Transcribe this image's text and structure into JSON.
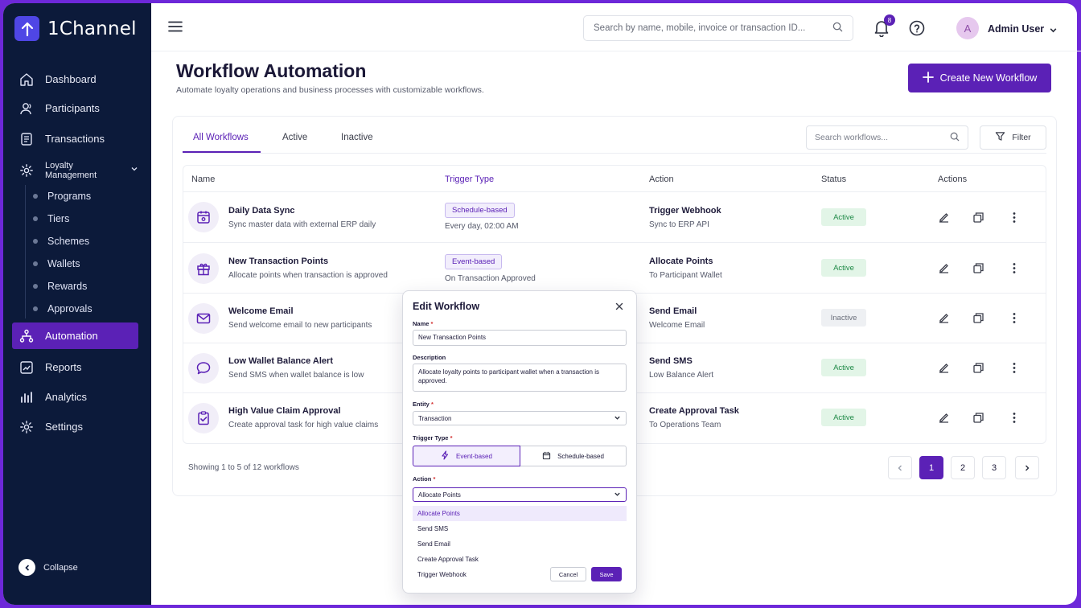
{
  "brand": {
    "name": "1Channel"
  },
  "sidebar": {
    "items": [
      {
        "label": "Dashboard",
        "icon": "home-icon"
      },
      {
        "label": "Participants",
        "icon": "users-icon"
      },
      {
        "label": "Transactions",
        "icon": "receipt-icon"
      },
      {
        "label": "Loyalty Management",
        "icon": "gear-icon"
      },
      {
        "label": "Automation",
        "icon": "workflow-icon"
      },
      {
        "label": "Reports",
        "icon": "chart-line-icon"
      },
      {
        "label": "Analytics",
        "icon": "bar-chart-icon"
      },
      {
        "label": "Settings",
        "icon": "settings-icon"
      }
    ],
    "sub_items": [
      "Programs",
      "Tiers",
      "Schemes",
      "Wallets",
      "Rewards",
      "Approvals"
    ],
    "collapse_label": "Collapse",
    "active": "Automation"
  },
  "topbar": {
    "search_placeholder": "Search by name, mobile, invoice or transaction ID...",
    "notification_count": "8",
    "avatar_initial": "A",
    "user_name": "Admin User"
  },
  "page": {
    "title": "Workflow Automation",
    "subtitle": "Automate loyalty operations and business processes with customizable workflows.",
    "create_label": "Create New Workflow"
  },
  "tabs": [
    {
      "label": "All Workflows",
      "active": true
    },
    {
      "label": "Active",
      "active": false
    },
    {
      "label": "Inactive",
      "active": false
    }
  ],
  "toolbar": {
    "search_placeholder": "Search workflows...",
    "filter_label": "Filter"
  },
  "table": {
    "headers": [
      "Name",
      "Trigger Type",
      "Action",
      "Status",
      "Actions"
    ],
    "rows": [
      {
        "name": "Daily Data Sync",
        "desc": "Sync master data with external ERP daily",
        "trigger": "Schedule-based",
        "trigger_detail": "Every day, 02:00 AM",
        "action": "Trigger Webhook",
        "action_detail": "Sync to ERP API",
        "status": "Active",
        "icon": "calendar-icon"
      },
      {
        "name": "New Transaction Points",
        "desc": "Allocate points when transaction is approved",
        "trigger": "Event-based",
        "trigger_detail": "On Transaction Approved",
        "action": "Allocate Points",
        "action_detail": "To Participant Wallet",
        "status": "Active",
        "icon": "gift-icon"
      },
      {
        "name": "Welcome Email",
        "desc": "Send welcome email to new participants",
        "trigger": "",
        "trigger_detail": "",
        "action": "Send Email",
        "action_detail": "Welcome Email",
        "status": "Inactive",
        "icon": "mail-icon"
      },
      {
        "name": "Low Wallet Balance Alert",
        "desc": "Send SMS when wallet balance is low",
        "trigger": "",
        "trigger_detail": "",
        "action": "Send SMS",
        "action_detail": "Low Balance Alert",
        "status": "Active",
        "icon": "chat-icon"
      },
      {
        "name": "High Value Claim Approval",
        "desc": "Create approval task for high value claims",
        "trigger": "",
        "trigger_detail": "",
        "action": "Create Approval Task",
        "action_detail": "To Operations Team",
        "status": "Active",
        "icon": "clipboard-check-icon"
      }
    ]
  },
  "footer": {
    "showing": "Showing 1 to 5 of 12 workflows",
    "pages": [
      "1",
      "2",
      "3"
    ],
    "current_page": "1"
  },
  "modal": {
    "title": "Edit Workflow",
    "name_label": "Name",
    "name_value": "New Transaction Points",
    "description_label": "Description",
    "description_value": "Allocate loyalty points to participant wallet when a transaction is approved.",
    "entity_label": "Entity",
    "entity_value": "Transaction",
    "trigger_label": "Trigger Type",
    "trigger_options": [
      "Event-based",
      "Schedule-based"
    ],
    "trigger_selected": "Event-based",
    "action_label": "Action",
    "action_value": "Allocate Points",
    "action_options": [
      "Allocate Points",
      "Send SMS",
      "Send Email",
      "Create Approval Task",
      "Trigger Webhook"
    ],
    "required_mark": "*",
    "cancel_label": "Cancel",
    "save_label": "Save"
  },
  "colors": {
    "primary": "#5b21b6",
    "sidebar_bg": "#0c1a3a",
    "active_green": "#1f8a47"
  }
}
